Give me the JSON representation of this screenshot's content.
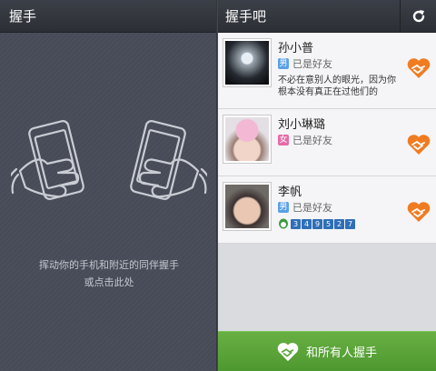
{
  "left": {
    "title": "握手",
    "hint_line1": "挥动你的手机和附近的同伴握手",
    "hint_line2": "或点击此处"
  },
  "right": {
    "title": "握手吧",
    "refresh_icon": "refresh-icon",
    "friends": [
      {
        "name": "孙小普",
        "gender": "男",
        "gender_color": "#5aa0e6",
        "status": "已是好友",
        "bio": "不必在意别人的眼光，因为你根本没有真正在过他们的"
      },
      {
        "name": "刘小琳璐",
        "gender": "女",
        "gender_color": "#e66aa8",
        "status": "已是好友"
      },
      {
        "name": "李帆",
        "gender": "男",
        "gender_color": "#5aa0e6",
        "status": "已是好友",
        "qq_digits": [
          "3",
          "4",
          "9",
          "5",
          "2",
          "7"
        ]
      }
    ],
    "shake_all_label": "和所有人握手",
    "accent_green": "#5aa53a",
    "accent_orange": "#f07c22"
  }
}
